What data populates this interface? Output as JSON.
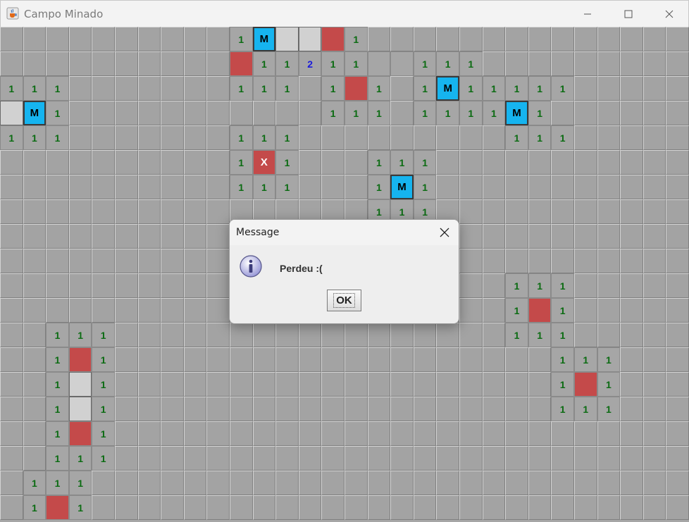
{
  "window": {
    "title": "Campo Minado",
    "app_icon": "java-cup-icon",
    "controls": [
      "minimize-icon",
      "maximize-icon",
      "close-icon"
    ]
  },
  "board": {
    "rows": 20,
    "cols": 30,
    "legend": {
      ".": "unrevealed",
      "0": "revealed-empty",
      "1": "number 1",
      "2": "number 2",
      "M": "flagged (marked)",
      "B": "revealed mine",
      "X": "exploded mine",
      "W": "revealed blank (light)"
    },
    "grid": [
      "..........1MWWB1..............",
      "..........B1121100111.........",
      "111.......111.1B1.1M11111.....",
      "WM1...........111.1111M1......",
      "111.......111.........111.....",
      "..........1X1...111...........",
      "..........111...1M1...........",
      "................111...........",
      "..............................",
      "..............................",
      "......................111.....",
      "......................1B1.....",
      "..111.................111.....",
      "..1B1...................111...",
      "..1W1...................1B1...",
      "..1W1...................111...",
      "..1B1.........................",
      "..111.........................",
      ".111..........................",
      ".1B1.........................."
    ],
    "colors": {
      "unrevealed": "#a3a3a3",
      "mine": "#c44a4a",
      "flag": "#16b4ef",
      "number1": "#0b6b12",
      "number2": "#1a1adc"
    }
  },
  "dialog": {
    "title": "Message",
    "message": "Perdeu :(",
    "ok_label": "OK",
    "icon": "info-icon"
  }
}
